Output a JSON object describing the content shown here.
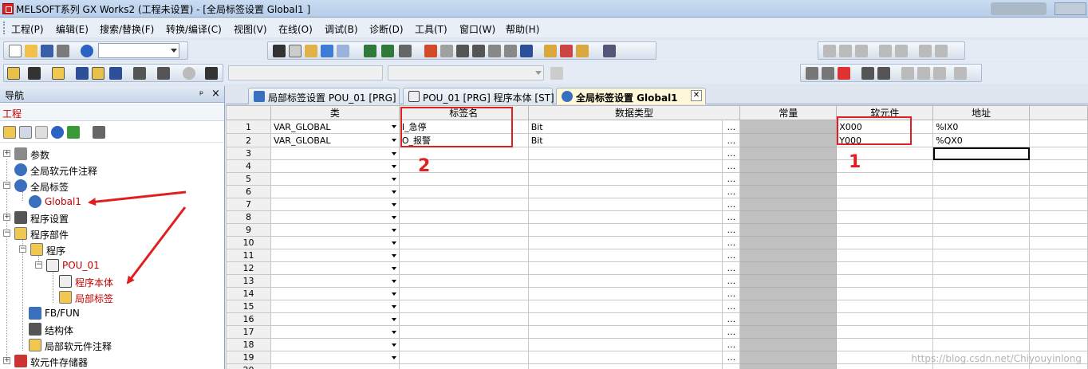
{
  "window": {
    "title": "MELSOFT系列 GX Works2 (工程未设置) - [全局标签设置 Global1 ]"
  },
  "menu": [
    "工程(P)",
    "编辑(E)",
    "搜索/替换(F)",
    "转换/编译(C)",
    "视图(V)",
    "在线(O)",
    "调试(B)",
    "诊断(D)",
    "工具(T)",
    "窗口(W)",
    "帮助(H)"
  ],
  "toolbar": {
    "combo1_value": ""
  },
  "nav": {
    "title": "导航",
    "pin": "ᵖ",
    "close": "×",
    "project_label": "工程",
    "tree": [
      {
        "label": "参数",
        "icon": "parameter-icon",
        "red": false
      },
      {
        "label": "全局软元件注释",
        "icon": "global-comment-icon",
        "red": false
      },
      {
        "label": "全局标签",
        "icon": "global-label-icon",
        "red": false
      },
      {
        "label": "Global1",
        "icon": "global-label-item-icon",
        "red": true
      },
      {
        "label": "程序设置",
        "icon": "program-setting-icon",
        "red": false
      },
      {
        "label": "程序部件",
        "icon": "program-parts-icon",
        "red": false
      },
      {
        "label": "程序",
        "icon": "program-folder-icon",
        "red": false
      },
      {
        "label": "POU_01",
        "icon": "st-pou-icon",
        "red": true
      },
      {
        "label": "程序本体",
        "icon": "st-body-icon",
        "red": true
      },
      {
        "label": "局部标签",
        "icon": "local-label-icon",
        "red": true
      },
      {
        "label": "FB/FUN",
        "icon": "fbfun-icon",
        "red": false
      },
      {
        "label": "结构体",
        "icon": "struct-icon",
        "red": false
      },
      {
        "label": "局部软元件注释",
        "icon": "local-comment-icon",
        "red": false
      },
      {
        "label": "软元件存储器",
        "icon": "device-memory-icon",
        "red": false
      }
    ]
  },
  "tabs": [
    {
      "label": "局部标签设置 POU_01 [PRG]",
      "active": false
    },
    {
      "label": "POU_01 [PRG] 程序本体 [ST]",
      "active": false
    },
    {
      "label": "全局标签设置 Global1",
      "active": true
    }
  ],
  "grid": {
    "headers": {
      "class": "类",
      "label_name": "标签名",
      "data_type": "数据类型",
      "constant": "常量",
      "device": "软元件",
      "address": "地址"
    },
    "rows": [
      {
        "num": "1",
        "class": "VAR_GLOBAL",
        "label": "I_急停",
        "type": "Bit",
        "dots": "...",
        "device": "X000",
        "address": "%IX0"
      },
      {
        "num": "2",
        "class": "VAR_GLOBAL",
        "label": "O_报警",
        "type": "Bit",
        "dots": "...",
        "device": "Y000",
        "address": "%QX0"
      },
      {
        "num": "3",
        "class": "",
        "label": "",
        "type": "",
        "dots": "...",
        "device": "",
        "address": ""
      },
      {
        "num": "4",
        "class": "",
        "label": "",
        "type": "",
        "dots": "...",
        "device": "",
        "address": ""
      },
      {
        "num": "5",
        "class": "",
        "label": "",
        "type": "",
        "dots": "...",
        "device": "",
        "address": ""
      },
      {
        "num": "6",
        "class": "",
        "label": "",
        "type": "",
        "dots": "...",
        "device": "",
        "address": ""
      },
      {
        "num": "7",
        "class": "",
        "label": "",
        "type": "",
        "dots": "...",
        "device": "",
        "address": ""
      },
      {
        "num": "8",
        "class": "",
        "label": "",
        "type": "",
        "dots": "...",
        "device": "",
        "address": ""
      },
      {
        "num": "9",
        "class": "",
        "label": "",
        "type": "",
        "dots": "...",
        "device": "",
        "address": ""
      },
      {
        "num": "10",
        "class": "",
        "label": "",
        "type": "",
        "dots": "...",
        "device": "",
        "address": ""
      },
      {
        "num": "11",
        "class": "",
        "label": "",
        "type": "",
        "dots": "...",
        "device": "",
        "address": ""
      },
      {
        "num": "12",
        "class": "",
        "label": "",
        "type": "",
        "dots": "...",
        "device": "",
        "address": ""
      },
      {
        "num": "13",
        "class": "",
        "label": "",
        "type": "",
        "dots": "...",
        "device": "",
        "address": ""
      },
      {
        "num": "14",
        "class": "",
        "label": "",
        "type": "",
        "dots": "...",
        "device": "",
        "address": ""
      },
      {
        "num": "15",
        "class": "",
        "label": "",
        "type": "",
        "dots": "...",
        "device": "",
        "address": ""
      },
      {
        "num": "16",
        "class": "",
        "label": "",
        "type": "",
        "dots": "...",
        "device": "",
        "address": ""
      },
      {
        "num": "17",
        "class": "",
        "label": "",
        "type": "",
        "dots": "...",
        "device": "",
        "address": ""
      },
      {
        "num": "18",
        "class": "",
        "label": "",
        "type": "",
        "dots": "...",
        "device": "",
        "address": ""
      },
      {
        "num": "19",
        "class": "",
        "label": "",
        "type": "",
        "dots": "...",
        "device": "",
        "address": ""
      },
      {
        "num": "20",
        "class": "",
        "label": "",
        "type": "",
        "dots": "...",
        "device": "",
        "address": ""
      }
    ]
  },
  "annotations": {
    "num1": "1",
    "num2": "2"
  },
  "watermark": "https://blog.csdn.net/Chiyouyinlong",
  "colors": {
    "annotation_red": "#e02020",
    "tree_red": "#c00000",
    "constant_column": "#c0c0c0"
  }
}
